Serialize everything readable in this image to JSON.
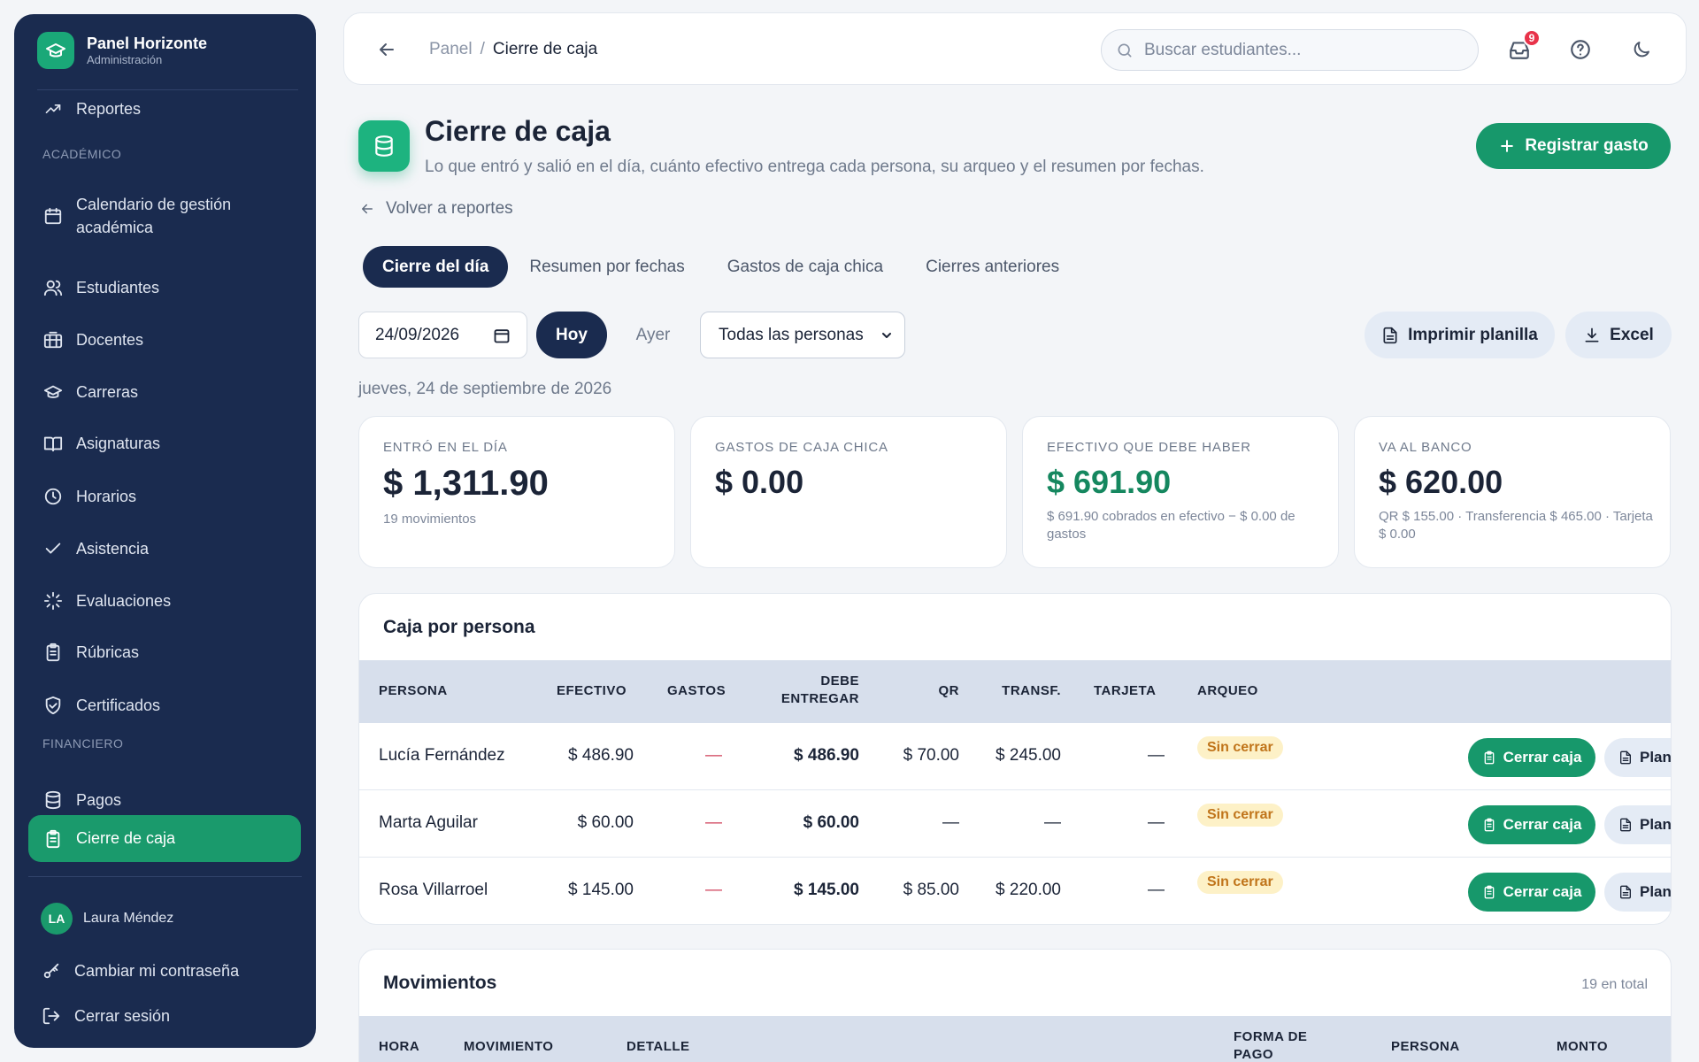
{
  "sidebar": {
    "brand_title": "Panel Horizonte",
    "brand_sub": "Administración",
    "items_top": [
      {
        "label": "Reportes",
        "icon": "trending-up-icon"
      }
    ],
    "section_academic": "ACADÉMICO",
    "academic": [
      {
        "label": "Calendario de gestión académica",
        "icon": "calendar-icon"
      },
      {
        "label": "Estudiantes",
        "icon": "users-icon"
      },
      {
        "label": "Docentes",
        "icon": "building-icon"
      },
      {
        "label": "Carreras",
        "icon": "graduation-cap-icon"
      },
      {
        "label": "Asignaturas",
        "icon": "book-open-icon"
      },
      {
        "label": "Horarios",
        "icon": "clock-icon"
      },
      {
        "label": "Asistencia",
        "icon": "check-icon"
      },
      {
        "label": "Evaluaciones",
        "icon": "loader-icon"
      },
      {
        "label": "Rúbricas",
        "icon": "clipboard-icon"
      },
      {
        "label": "Certificados",
        "icon": "shield-check-icon"
      }
    ],
    "section_financial": "FINANCIERO",
    "financial": [
      {
        "label": "Pagos",
        "icon": "database-icon"
      },
      {
        "label": "Cierre de caja",
        "icon": "clipboard-icon",
        "active": true
      }
    ],
    "user_initials": "LA",
    "user_name": "Laura Méndez",
    "change_password": "Cambiar mi contraseña",
    "logout": "Cerrar sesión"
  },
  "topbar": {
    "breadcrumb_parent": "Panel",
    "breadcrumb_sep": "/",
    "breadcrumb_current": "Cierre de caja",
    "search_placeholder": "Buscar estudiantes...",
    "notifications_count": "9"
  },
  "page": {
    "title": "Cierre de caja",
    "subtitle": "Lo que entró y salió en el día, cuánto efectivo entrega cada persona, su arqueo y el resumen por fechas.",
    "primary_button": "Registrar gasto",
    "back_link": "Volver a reportes",
    "tabs": [
      {
        "label": "Cierre del día",
        "active": true
      },
      {
        "label": "Resumen por fechas"
      },
      {
        "label": "Gastos de caja chica"
      },
      {
        "label": "Cierres anteriores"
      }
    ],
    "date_value": "24/09/2026",
    "today_button": "Hoy",
    "yesterday_button": "Ayer",
    "person_filter": "Todas las personas",
    "print_button": "Imprimir planilla",
    "excel_button": "Excel",
    "date_text": "jueves, 24 de septiembre de 2026"
  },
  "cards": [
    {
      "label": "ENTRÓ EN EL DÍA",
      "value": "$ 1,311.90",
      "note": "19 movimientos"
    },
    {
      "label": "GASTOS DE CAJA CHICA",
      "value": "$ 0.00",
      "note": ""
    },
    {
      "label": "EFECTIVO QUE DEBE HABER",
      "value": "$ 691.90",
      "note": "$ 691.90 cobrados en efectivo − $ 0.00 de gastos"
    },
    {
      "label": "VA AL BANCO",
      "value": "$ 620.00",
      "note": "QR $ 155.00 · Transferencia $ 465.00 · Tarjeta $ 0.00"
    }
  ],
  "per_person": {
    "title": "Caja por persona",
    "headers": {
      "persona": "PERSONA",
      "efectivo": "EFECTIVO",
      "gastos": "GASTOS",
      "debe1": "DEBE",
      "debe2": "ENTREGAR",
      "qr": "QR",
      "transf": "TRANSF.",
      "tarjeta": "TARJETA",
      "arqueo": "ARQUEO"
    },
    "close_label": "Cerrar caja",
    "plan_label": "Plan",
    "rows": [
      {
        "persona": "Lucía Fernández",
        "efectivo": "$ 486.90",
        "gastos": "—",
        "debe": "$ 486.90",
        "qr": "$ 70.00",
        "transf": "$ 245.00",
        "tarjeta": "—",
        "arqueo": "Sin cerrar"
      },
      {
        "persona": "Marta Aguilar",
        "efectivo": "$ 60.00",
        "gastos": "—",
        "debe": "$ 60.00",
        "qr": "—",
        "transf": "—",
        "tarjeta": "—",
        "arqueo": "Sin cerrar"
      },
      {
        "persona": "Rosa Villarroel",
        "efectivo": "$ 145.00",
        "gastos": "—",
        "debe": "$ 145.00",
        "qr": "$ 85.00",
        "transf": "$ 220.00",
        "tarjeta": "—",
        "arqueo": "Sin cerrar"
      }
    ]
  },
  "movements": {
    "title": "Movimientos",
    "total": "19 en total",
    "headers": {
      "hora": "HORA",
      "movimiento": "MOVIMIENTO",
      "detalle": "DETALLE",
      "forma1": "FORMA DE",
      "forma2": "PAGO",
      "persona": "PERSONA",
      "monto": "MONTO"
    }
  }
}
